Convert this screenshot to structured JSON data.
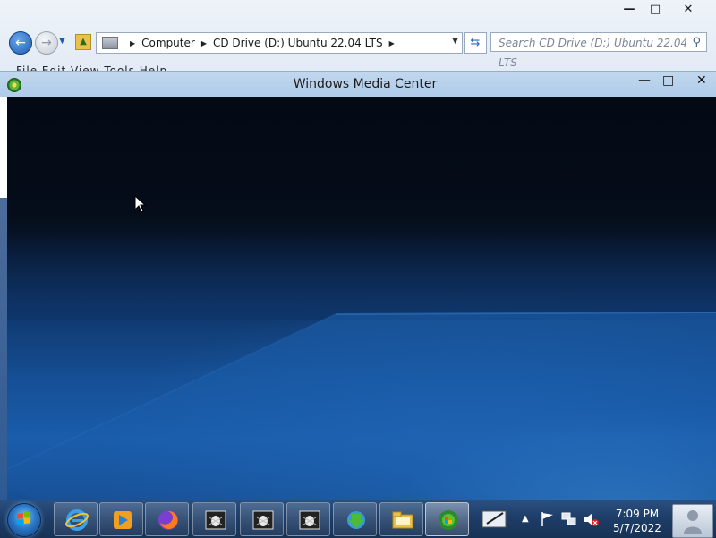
{
  "explorer": {
    "window_controls": {
      "minimize": "—",
      "maximize": "□",
      "close": "✕"
    },
    "nav": {
      "back": "←",
      "forward": "→"
    },
    "breadcrumbs": [
      "Computer",
      "CD Drive (D:) Ubuntu 22.04 LTS"
    ],
    "search": {
      "placeholder": "Search CD Drive (D:) Ubuntu 22.04 LTS"
    },
    "menu": [
      "File",
      "Edit",
      "View",
      "Tools",
      "Help"
    ]
  },
  "wmc": {
    "title": "Windows Media Center",
    "controls": {
      "minimize": "—",
      "maximize": "□",
      "close": "✕"
    }
  },
  "taskbar": {
    "pinned": [
      "internet-explorer",
      "windows-media-player",
      "firefox",
      "app-bug-1",
      "app-bug-2",
      "app-bug-3",
      "download-manager",
      "file-explorer",
      "windows-media-center"
    ],
    "active": "windows-media-center",
    "clock": {
      "time": "7:09 PM",
      "date": "5/7/2022"
    }
  },
  "colors": {
    "taskbar": "#1d3c66",
    "titlebar": "#b8d1ec",
    "wmc_background": "#0a1f3e"
  }
}
